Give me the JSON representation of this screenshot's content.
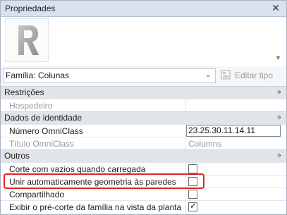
{
  "panel": {
    "title": "Propriedades",
    "close_icon": "close-icon"
  },
  "preview": {
    "icon": "revit-r-logo-icon",
    "dropdown_icon": "chevron-down-icon"
  },
  "type_selector": {
    "value": "Família: Colunas",
    "dropdown_icon": "chevron-down-icon"
  },
  "edit_type": {
    "label": "Editar tipo",
    "icon": "edit-type-icon"
  },
  "categories": [
    {
      "label": "Restrições",
      "rows": [
        {
          "name": "Hospedeiro",
          "value": "",
          "muted": true
        }
      ]
    },
    {
      "label": "Dados de identidade",
      "rows": [
        {
          "name": "Número OmniClass",
          "value": "23.25.30.11.14.11"
        },
        {
          "name": "Título OmniClass",
          "value": "Columns",
          "muted": true
        }
      ]
    },
    {
      "label": "Outros",
      "rows": [
        {
          "name": "Corte com vazios quando carregada",
          "checked": false
        },
        {
          "name": "Unir automaticamente geometria às paredes",
          "checked": false
        },
        {
          "name": "Compartilhado",
          "checked": false
        },
        {
          "name": "Exibir o pré-corte da família na vista da planta",
          "checked": true
        }
      ]
    }
  ],
  "collapse_glyph": "»",
  "check_glyph": "✓",
  "colors": {
    "titlebar": "#d9e2ec",
    "category_bg": "#e1e4e8",
    "highlight": "#e0252b"
  }
}
